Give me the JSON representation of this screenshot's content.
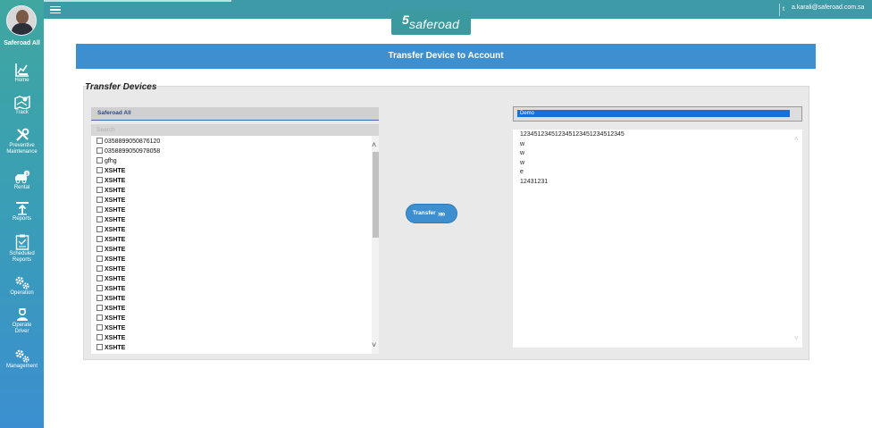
{
  "sidebar": {
    "user_name": "Saferoad All",
    "items": [
      {
        "label": "Home",
        "icon": "chart-icon"
      },
      {
        "label": "Track",
        "icon": "map-icon"
      },
      {
        "label": "Preventive",
        "label2": "Maintenance",
        "icon": "tools-icon"
      },
      {
        "label": "Rental",
        "icon": "car-icon"
      },
      {
        "label": "Reports",
        "icon": "reports-icon"
      },
      {
        "label": "Scheduled",
        "label2": "Reports",
        "icon": "clipboard-icon"
      },
      {
        "label": "Operation",
        "icon": "gears-icon"
      },
      {
        "label": "Operate",
        "label2": "Driver",
        "icon": "driver-icon"
      },
      {
        "label": "Management",
        "icon": "gears-icon"
      }
    ]
  },
  "topbar": {
    "lock_glyph": "t",
    "email": "a.karali@saferoad.com.sa"
  },
  "logo": {
    "mark": "5",
    "text": "saferoad"
  },
  "page_title": "Transfer Device to Account",
  "panel_title": "Transfer Devices",
  "left": {
    "header": "Saferoad All",
    "search_placeholder": "Search",
    "devices": [
      "0358899050876120",
      "0358899050978058",
      "gfhg",
      "XSHTE",
      "XSHTE",
      "XSHTE",
      "XSHTE",
      "XSHTE",
      "XSHTE",
      "XSHTE",
      "XSHTE",
      "XSHTE",
      "XSHTE",
      "XSHTE",
      "XSHTE",
      "XSHTE",
      "XSHTE",
      "XSHTE",
      "XSHTE",
      "XSHTE",
      "XSHTE",
      "XSHTE"
    ]
  },
  "transfer_button": {
    "label": "Transfer",
    "arrows": "»»"
  },
  "right": {
    "selected_account": "Demo",
    "devices": [
      "123451234512345123451234512345",
      "w",
      "w",
      "w",
      "e",
      "12431231"
    ]
  },
  "colors": {
    "sidebar_top": "#3fa6a0",
    "sidebar_bottom": "#3b8fd0",
    "banner": "#3d8fcf",
    "selection": "#1a6fd6"
  }
}
